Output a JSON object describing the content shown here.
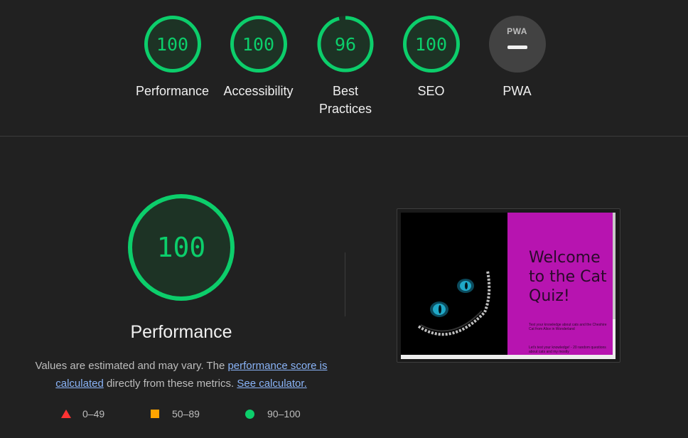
{
  "summary": {
    "gauges": [
      {
        "score": "100",
        "label": "Performance"
      },
      {
        "score": "100",
        "label": "Accessibility"
      },
      {
        "score": "96",
        "label": "Best Practices",
        "fraction": 0.96
      },
      {
        "score": "100",
        "label": "SEO"
      }
    ],
    "pwa": {
      "badge_text": "PWA",
      "label": "PWA"
    }
  },
  "performance": {
    "score": "100",
    "title": "Performance",
    "desc_pre": "Values are estimated and may vary. The ",
    "link_score": "performance score is calculated",
    "desc_mid": " directly from these metrics. ",
    "link_calc": "See calculator."
  },
  "legend": [
    {
      "range": "0–49",
      "color": "#ff3333",
      "shape": "triangle"
    },
    {
      "range": "50–89",
      "color": "#ffa400",
      "shape": "square"
    },
    {
      "range": "90–100",
      "color": "#0cce6b",
      "shape": "circle"
    }
  ],
  "screenshot": {
    "heading": "Welcome to the Cat Quiz!",
    "para1": "Test your knowledge about cats and the Cheshire Cat from Alice in Wonderland",
    "para2": "Let's test your knowledge! - 20 random questions about cats and my mostly"
  },
  "colors": {
    "pass": "#0cce6b",
    "background": "#212121",
    "link": "#8ab4f8"
  }
}
